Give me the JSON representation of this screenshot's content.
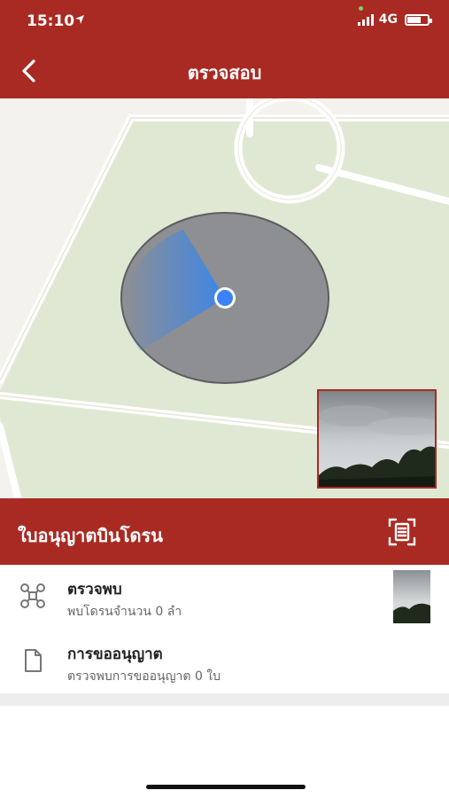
{
  "status_bar": {
    "time": "15:10",
    "network": "4G"
  },
  "header": {
    "title": "ตรวจสอบ"
  },
  "section": {
    "title": "ใบอนุญาตบินโดรน"
  },
  "list": [
    {
      "title": "ตรวจพบ",
      "subtitle": "พบโดรนจำนวน 0 ลำ",
      "icon": "drone-icon"
    },
    {
      "title": "การขออนุญาต",
      "subtitle": "ตรวจพบการขออนุญาต 0 ใบ",
      "icon": "document-icon"
    }
  ],
  "colors": {
    "primary": "#a92a23",
    "map_park": "#dfe8d3",
    "map_road": "#ffffff",
    "radar": "#8d8f93",
    "location_dot": "#3b82f6"
  },
  "icons": {
    "back": "chevron-left-icon",
    "scan": "scan-document-icon",
    "location_arrow": "location-arrow-icon"
  }
}
